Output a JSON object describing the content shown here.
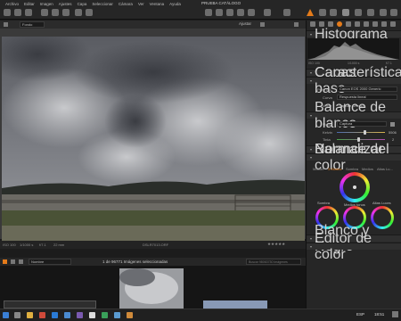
{
  "menu": {
    "items": [
      "Archivo",
      "Editar",
      "Imagen",
      "Ajustes",
      "Capa",
      "Seleccionar",
      "Cámara",
      "Ver",
      "Ventana",
      "Ayuda"
    ],
    "window_title": "PRUEBA CATÁLOGO"
  },
  "viewer": {
    "mode": "Fondo",
    "adjust_label": "Ajustar"
  },
  "status": {
    "iso": "ISO 100",
    "shutter": "1/1000 s",
    "aperture": "f/7.1",
    "focal": "22 mm",
    "filename": "DSLR7013.ORF",
    "rating": "★★★★★"
  },
  "browser": {
    "sort": "Nombre",
    "count_text": "1 de 96771 Imágenes seleccionadas",
    "search_placeholder": "Buscar 98063730 Imágenes"
  },
  "panel": {
    "histogram": "Histograma",
    "hist_iso": "ISO 100",
    "hist_shutter": "1/1000 s",
    "hist_ap": "f/7.1",
    "capa": "Capas",
    "base": "Características base",
    "icc_label": "Perfil ICC",
    "icc_value": "Canon EOS 2000 Generic",
    "curve_label": "Curva",
    "curve_value": "Respuesta lineal",
    "engine_label": "Motor",
    "engine_value": "Capture One 12",
    "wb": "Balance de blanco",
    "mode_label": "Modo",
    "mode_value": "Captura",
    "kelvin_label": "Kelvin",
    "kelvin_value": "5506",
    "tint_label": "Tinta",
    "tint_value": "2",
    "normalize": "Normalizar",
    "color_balance": "Balance del color",
    "tabs": [
      "Master",
      "3 Modos",
      "Sombra",
      "Medios",
      "Altas Lu..."
    ],
    "shadow": "Sombra",
    "mid": "Medios tonos",
    "high": "Altas Luces",
    "bw": "Blanco y Negro",
    "color_editor": "Editor de color"
  },
  "taskbar": {
    "lang": "ESP",
    "time": "18:51"
  }
}
